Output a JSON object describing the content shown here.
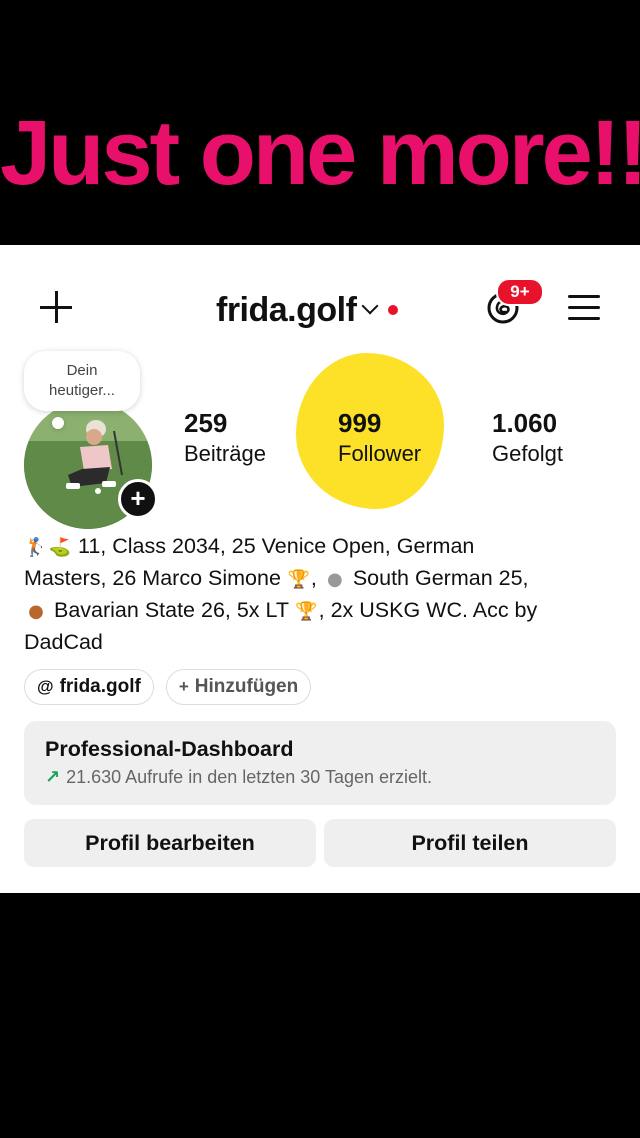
{
  "overlay": {
    "headline": "Just one more!!",
    "color": "#e8106a"
  },
  "header": {
    "username": "frida.golf",
    "notification_count": "9+"
  },
  "note": {
    "line1": "Dein",
    "line2": "heutiger..."
  },
  "stats": [
    {
      "value": "259",
      "label": "Beiträge"
    },
    {
      "value": "999",
      "label": "Follower"
    },
    {
      "value": "1.060",
      "label": "Gefolgt"
    }
  ],
  "bio": {
    "line1": "11, Class 2034, 25 Venice Open, German",
    "line2a": "Masters, 26 Marco Simone",
    "line2b": "South German 25,",
    "line3a": "Bavarian State 26, 5x LT",
    "line3b": ", 2x USKG WC. Acc by",
    "line4": "DadCad",
    "emojis": [
      "golfer",
      "golf-flag",
      "trophy",
      "silver-medal",
      "bronze-medal",
      "trophy"
    ]
  },
  "chips": {
    "threads_label": "frida.golf",
    "add_label": "Hinzufügen"
  },
  "dashboard": {
    "title": "Professional-Dashboard",
    "subtitle": "21.630 Aufrufe in den letzten 30 Tagen erzielt."
  },
  "buttons": {
    "edit_profile": "Profil bearbeiten",
    "share_profile": "Profil teilen"
  }
}
